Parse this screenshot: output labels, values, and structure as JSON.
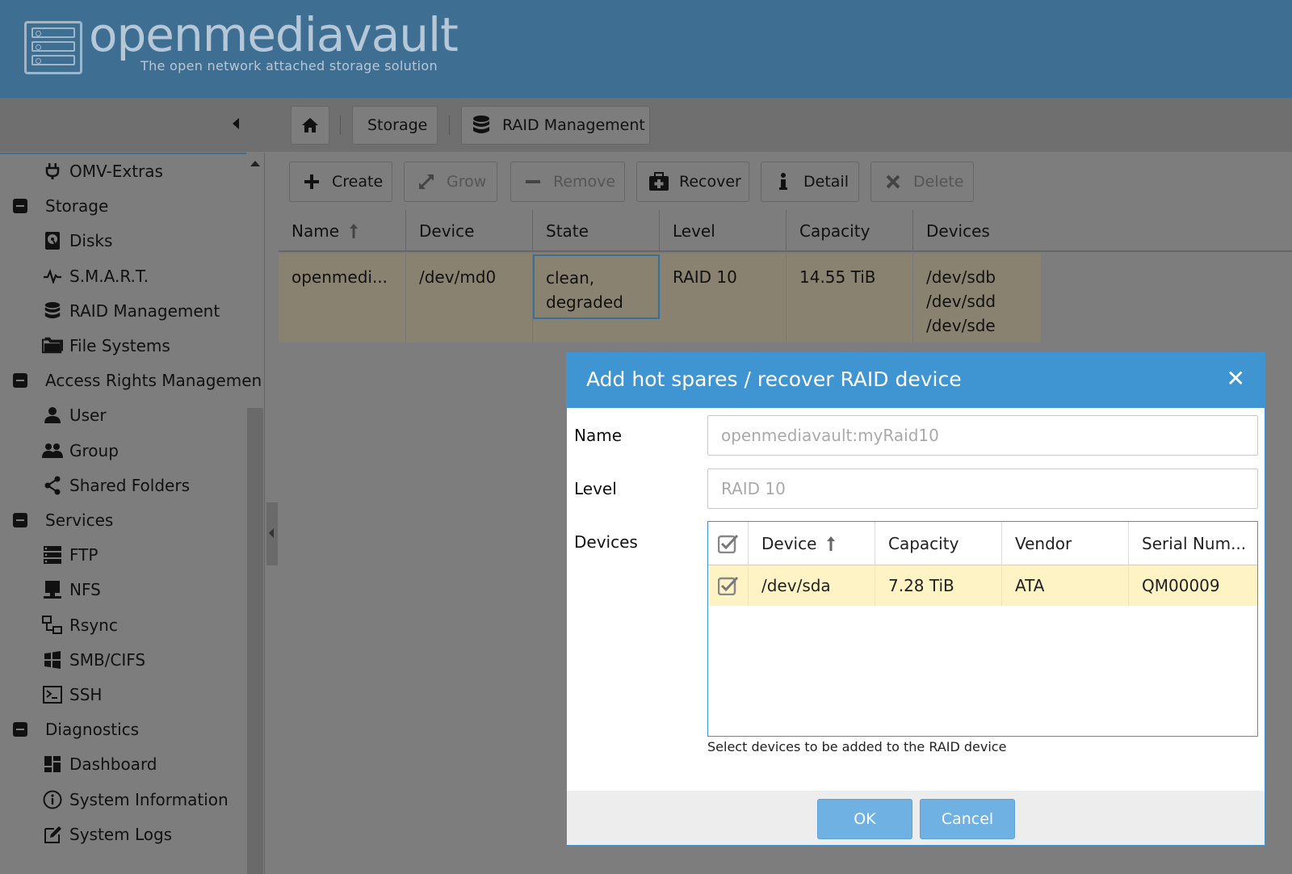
{
  "app": {
    "title": "openmediavault",
    "subtitle": "The open network attached storage solution"
  },
  "breadcrumb": {
    "items": [
      "Storage",
      "RAID Management"
    ]
  },
  "nav": {
    "items": [
      {
        "label": "OMV-Extras",
        "icon": "plug-icon",
        "group": false
      },
      {
        "label": "Storage",
        "icon": "collapse-icon",
        "group": true
      },
      {
        "label": "Disks",
        "icon": "disk-icon",
        "group": false
      },
      {
        "label": "S.M.A.R.T.",
        "icon": "pulse-icon",
        "group": false
      },
      {
        "label": "RAID Management",
        "icon": "database-icon",
        "group": false
      },
      {
        "label": "File Systems",
        "icon": "folder-icon",
        "group": false
      },
      {
        "label": "Access Rights Managemen",
        "icon": "collapse-icon",
        "group": true
      },
      {
        "label": "User",
        "icon": "user-icon",
        "group": false
      },
      {
        "label": "Group",
        "icon": "group-icon",
        "group": false
      },
      {
        "label": "Shared Folders",
        "icon": "share-icon",
        "group": false
      },
      {
        "label": "Services",
        "icon": "collapse-icon",
        "group": true
      },
      {
        "label": "FTP",
        "icon": "server-icon",
        "group": false
      },
      {
        "label": "NFS",
        "icon": "monitor-icon",
        "group": false
      },
      {
        "label": "Rsync",
        "icon": "network-icon",
        "group": false
      },
      {
        "label": "SMB/CIFS",
        "icon": "windows-icon",
        "group": false
      },
      {
        "label": "SSH",
        "icon": "terminal-icon",
        "group": false
      },
      {
        "label": "Diagnostics",
        "icon": "collapse-icon",
        "group": true
      },
      {
        "label": "Dashboard",
        "icon": "dashboard-icon",
        "group": false
      },
      {
        "label": "System Information",
        "icon": "info-icon",
        "group": false
      },
      {
        "label": "System Logs",
        "icon": "edit-icon",
        "group": false
      }
    ]
  },
  "toolbar": {
    "create": "Create",
    "grow": "Grow",
    "remove": "Remove",
    "recover": "Recover",
    "detail": "Detail",
    "delete": "Delete"
  },
  "grid": {
    "columns": [
      "Name",
      "Device",
      "State",
      "Level",
      "Capacity",
      "Devices"
    ],
    "row": {
      "name": "openmedi...",
      "device": "/dev/md0",
      "state_line1": "clean,",
      "state_line2": "degraded",
      "level": "RAID 10",
      "capacity": "14.55 TiB",
      "devices": [
        "/dev/sdb",
        "/dev/sdd",
        "/dev/sde"
      ]
    }
  },
  "dialog": {
    "title": "Add hot spares / recover RAID device",
    "name_label": "Name",
    "name_value": "openmediavault:myRaid10",
    "level_label": "Level",
    "level_value": "RAID 10",
    "devices_label": "Devices",
    "device_columns": [
      "Device",
      "Capacity",
      "Vendor",
      "Serial Num..."
    ],
    "device_rows": [
      {
        "device": "/dev/sda",
        "capacity": "7.28 TiB",
        "vendor": "ATA",
        "serial": "QM00009",
        "checked": true
      }
    ],
    "hint": "Select devices to be added to the RAID device",
    "ok": "OK",
    "cancel": "Cancel"
  },
  "colors": {
    "header": "#3f6e93",
    "dialog_accent": "#3e95d2",
    "selected_row": "#fdf3c4",
    "button_primary": "#6fb1e2"
  }
}
